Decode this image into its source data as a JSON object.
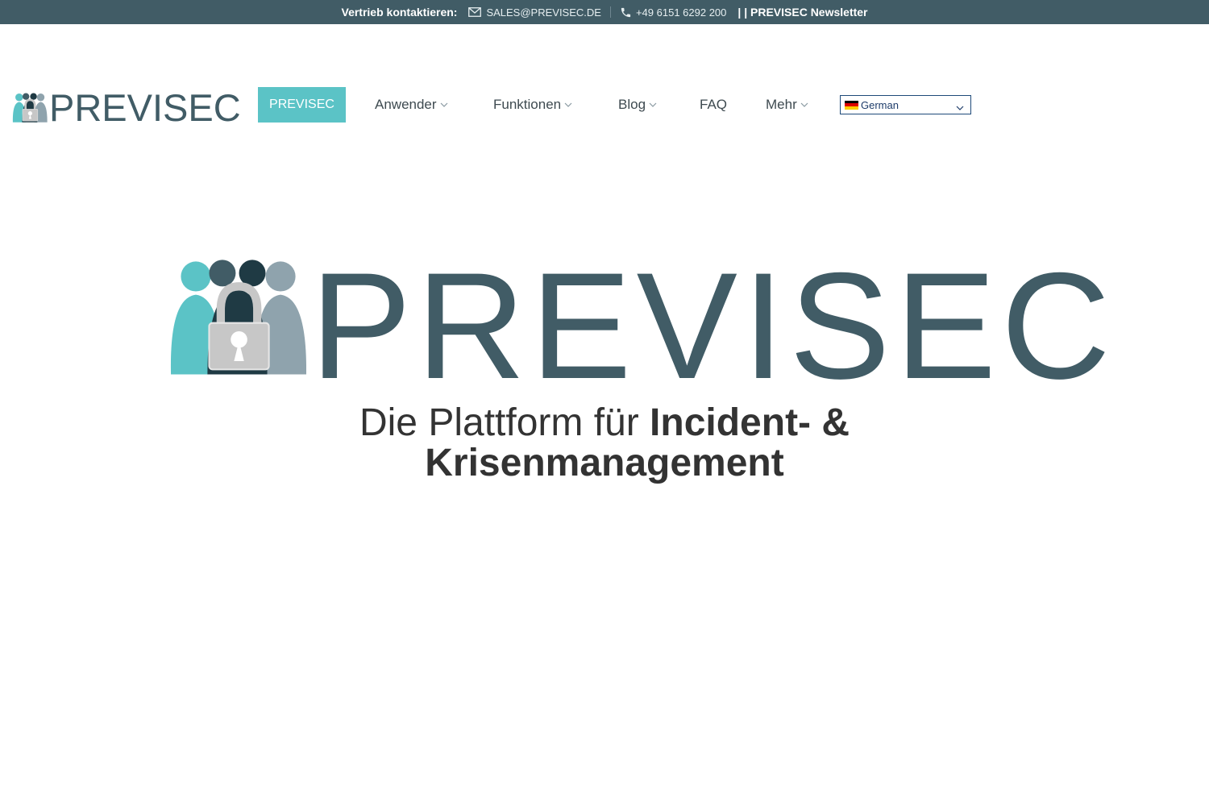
{
  "topbar": {
    "contact_label": "Vertrieb kontaktieren:",
    "email": "SALES@PREVISEC.DE",
    "phone": "+49 6151 6292 200",
    "newsletter": "| | PREVISEC Newsletter"
  },
  "header": {
    "logo_text": "PREVISEC",
    "nav": {
      "active": "PREVISEC",
      "anwender": "Anwender",
      "funktionen": "Funktionen",
      "blog": "Blog",
      "faq": "FAQ",
      "mehr": "Mehr"
    },
    "language": "German"
  },
  "hero": {
    "logo_text": "PREVISEC",
    "tagline_light": "Die Plattform für ",
    "tagline_bold_1": "Incident- &",
    "tagline_bold_2": "Krisenmanagement"
  },
  "colors": {
    "brand_dark": "#415c66",
    "brand_teal": "#5bc3c6",
    "brand_grey": "#8fa3ad"
  },
  "icons": [
    "envelope-icon",
    "phone-icon",
    "chevron-down-icon",
    "german-flag-icon",
    "lock-people-logo-icon"
  ]
}
